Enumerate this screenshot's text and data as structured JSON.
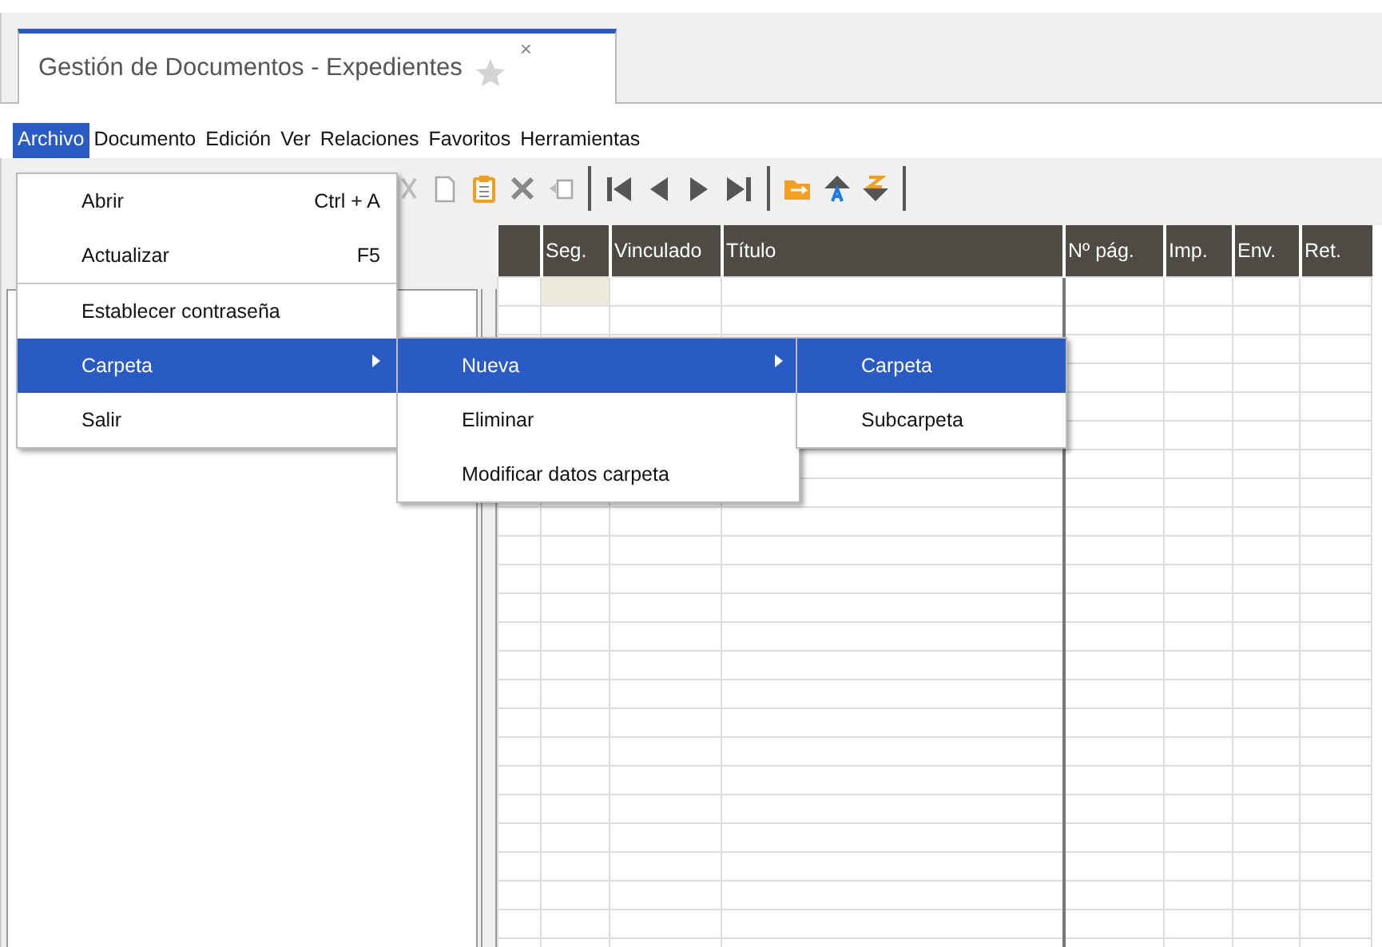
{
  "tab": {
    "title": "Gestión de Documentos - Expedientes",
    "favorite": false,
    "close": "×"
  },
  "menubar": [
    {
      "label": "Archivo",
      "selected": true
    },
    {
      "label": "Documento",
      "selected": false
    },
    {
      "label": "Edición",
      "selected": false
    },
    {
      "label": "Ver",
      "selected": false
    },
    {
      "label": "Relaciones",
      "selected": false
    },
    {
      "label": "Favoritos",
      "selected": false
    },
    {
      "label": "Herramientas",
      "selected": false
    }
  ],
  "toolbar": [
    {
      "kind": "cut"
    },
    {
      "kind": "copy"
    },
    {
      "kind": "paste"
    },
    {
      "kind": "delete"
    },
    {
      "kind": "move"
    },
    {
      "kind": "sep"
    },
    {
      "kind": "first"
    },
    {
      "kind": "prev"
    },
    {
      "kind": "next"
    },
    {
      "kind": "last"
    },
    {
      "kind": "sep"
    },
    {
      "kind": "folder"
    },
    {
      "kind": "sortup"
    },
    {
      "kind": "sortdown"
    },
    {
      "kind": "sep"
    }
  ],
  "grid": {
    "columns": [
      "",
      "Seg.",
      "Vinculado",
      "Título",
      "Nº pág.",
      "Imp.",
      "Env.",
      "Ret."
    ]
  },
  "menus": [
    {
      "items": [
        {
          "kind": "item",
          "label": "Abrir",
          "shortcut": "Ctrl + A",
          "selected": false,
          "submenu": false
        },
        {
          "kind": "item",
          "label": "Actualizar",
          "shortcut": "F5",
          "selected": false,
          "submenu": false
        },
        {
          "kind": "separator"
        },
        {
          "kind": "item",
          "label": "Establecer contraseña",
          "selected": false,
          "submenu": false
        },
        {
          "kind": "item",
          "label": "Carpeta",
          "selected": true,
          "submenu": true
        },
        {
          "kind": "item",
          "label": "Salir",
          "selected": false,
          "submenu": false
        }
      ]
    },
    {
      "items": [
        {
          "kind": "item",
          "label": "Nueva",
          "selected": true,
          "submenu": true
        },
        {
          "kind": "item",
          "label": "Eliminar",
          "selected": false,
          "submenu": false
        },
        {
          "kind": "item",
          "label": "Modificar datos carpeta",
          "selected": false,
          "submenu": false
        }
      ]
    },
    {
      "items": [
        {
          "kind": "item",
          "label": "Carpeta",
          "selected": true,
          "submenu": false
        },
        {
          "kind": "item",
          "label": "Subcarpeta",
          "selected": false,
          "submenu": false
        }
      ]
    }
  ]
}
